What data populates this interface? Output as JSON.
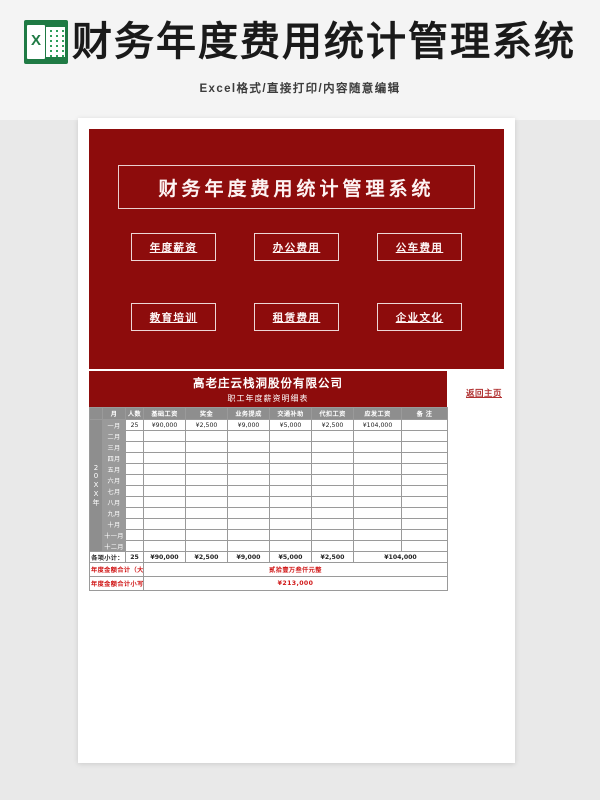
{
  "header": {
    "icon": "excel-icon",
    "title": "财务年度费用统计管理系统",
    "subtitle": "Excel格式/直接打印/内容随意编辑"
  },
  "hero": {
    "title": "财务年度费用统计管理系统",
    "background_color": "#8d0c0c",
    "buttons": [
      {
        "label": "年度薪资"
      },
      {
        "label": "办公费用"
      },
      {
        "label": "公车费用"
      },
      {
        "label": "教育培训"
      },
      {
        "label": "租赁费用"
      },
      {
        "label": "企业文化"
      }
    ]
  },
  "table": {
    "company": "高老庄云栈洞股份有限公司",
    "subtitle": "职工年度薪资明细表",
    "home_link": "返回主页",
    "year_label": "20XX年",
    "columns": [
      "月",
      "人数",
      "基础工资",
      "奖金",
      "业务提成",
      "交通补助",
      "代扣工资",
      "应发工资",
      "备 注"
    ],
    "rows": [
      {
        "month": "一月",
        "headcount": "25",
        "base": "¥90,000",
        "bonus": "¥2,500",
        "commission": "¥9,000",
        "transport": "¥5,000",
        "withheld": "¥2,500",
        "payable": "¥104,000",
        "remark": ""
      },
      {
        "month": "二月",
        "headcount": "",
        "base": "",
        "bonus": "",
        "commission": "",
        "transport": "",
        "withheld": "",
        "payable": "",
        "remark": ""
      },
      {
        "month": "三月",
        "headcount": "",
        "base": "",
        "bonus": "",
        "commission": "",
        "transport": "",
        "withheld": "",
        "payable": "",
        "remark": ""
      },
      {
        "month": "四月",
        "headcount": "",
        "base": "",
        "bonus": "",
        "commission": "",
        "transport": "",
        "withheld": "",
        "payable": "",
        "remark": ""
      },
      {
        "month": "五月",
        "headcount": "",
        "base": "",
        "bonus": "",
        "commission": "",
        "transport": "",
        "withheld": "",
        "payable": "",
        "remark": ""
      },
      {
        "month": "六月",
        "headcount": "",
        "base": "",
        "bonus": "",
        "commission": "",
        "transport": "",
        "withheld": "",
        "payable": "",
        "remark": ""
      },
      {
        "month": "七月",
        "headcount": "",
        "base": "",
        "bonus": "",
        "commission": "",
        "transport": "",
        "withheld": "",
        "payable": "",
        "remark": ""
      },
      {
        "month": "八月",
        "headcount": "",
        "base": "",
        "bonus": "",
        "commission": "",
        "transport": "",
        "withheld": "",
        "payable": "",
        "remark": ""
      },
      {
        "month": "九月",
        "headcount": "",
        "base": "",
        "bonus": "",
        "commission": "",
        "transport": "",
        "withheld": "",
        "payable": "",
        "remark": ""
      },
      {
        "month": "十月",
        "headcount": "",
        "base": "",
        "bonus": "",
        "commission": "",
        "transport": "",
        "withheld": "",
        "payable": "",
        "remark": ""
      },
      {
        "month": "十一月",
        "headcount": "",
        "base": "",
        "bonus": "",
        "commission": "",
        "transport": "",
        "withheld": "",
        "payable": "",
        "remark": ""
      },
      {
        "month": "十二月",
        "headcount": "",
        "base": "",
        "bonus": "",
        "commission": "",
        "transport": "",
        "withheld": "",
        "payable": "",
        "remark": ""
      }
    ],
    "subtotal": {
      "label": "各项小计：",
      "headcount": "25",
      "base": "¥90,000",
      "bonus": "¥2,500",
      "commission": "¥9,000",
      "transport": "¥5,000",
      "withheld": "¥2,500",
      "payable": "¥104,000"
    },
    "total_upper": {
      "label": "年度金额合计（大写）：",
      "value": "贰拾壹万叁仟元整"
    },
    "total_lower": {
      "label": "年度金额合计小写    ：",
      "value": "¥213,000"
    },
    "accent_color": "#d01616"
  }
}
